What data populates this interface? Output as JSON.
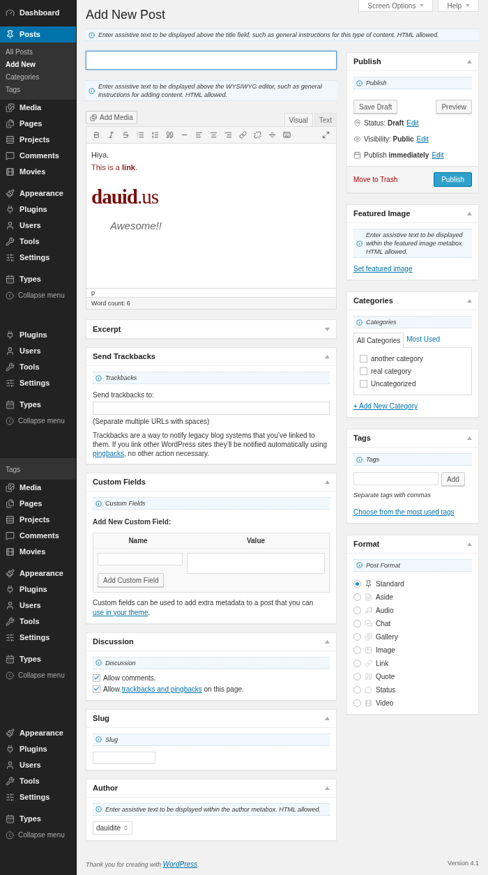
{
  "sidebar": {
    "sections": [
      {
        "groups": [
          {
            "kind": "menu",
            "items": [
              {
                "label": "Dashboard",
                "selected": false
              }
            ]
          },
          {
            "kind": "menu",
            "items": [
              {
                "label": "Posts",
                "selected": true,
                "children": [
                  {
                    "label": "All Posts",
                    "selected": false
                  },
                  {
                    "label": "Add New",
                    "selected": true
                  },
                  {
                    "label": "Categories",
                    "selected": false
                  },
                  {
                    "label": "Tags",
                    "selected": false
                  }
                ]
              },
              {
                "label": "Media",
                "selected": false
              },
              {
                "label": "Pages",
                "selected": false
              },
              {
                "label": "Projects",
                "selected": false
              },
              {
                "label": "Comments",
                "selected": false
              },
              {
                "label": "Movies",
                "selected": false
              }
            ]
          },
          {
            "kind": "menu",
            "items": [
              {
                "label": "Appearance",
                "selected": false
              },
              {
                "label": "Plugins",
                "selected": false
              },
              {
                "label": "Users",
                "selected": false
              },
              {
                "label": "Tools",
                "selected": false
              },
              {
                "label": "Settings",
                "selected": false
              }
            ]
          },
          {
            "kind": "menu",
            "items": [
              {
                "label": "Types",
                "selected": false
              }
            ]
          },
          {
            "kind": "collapse",
            "label": "Collapse menu"
          }
        ]
      },
      {
        "groups": [
          {
            "kind": "menu",
            "items": [
              {
                "label": "Plugins",
                "selected": false
              },
              {
                "label": "Users",
                "selected": false
              },
              {
                "label": "Tools",
                "selected": false
              },
              {
                "label": "Settings",
                "selected": false
              }
            ]
          },
          {
            "kind": "menu",
            "items": [
              {
                "label": "Types",
                "selected": false
              }
            ]
          },
          {
            "kind": "collapse",
            "label": "Collapse menu"
          }
        ]
      },
      {
        "groups": [
          {
            "kind": "submenu",
            "items": [
              {
                "label": "Tags",
                "selected": false
              }
            ]
          },
          {
            "kind": "menu",
            "items": [
              {
                "label": "Media",
                "selected": false
              },
              {
                "label": "Pages",
                "selected": false
              },
              {
                "label": "Projects",
                "selected": false
              },
              {
                "label": "Comments",
                "selected": false
              },
              {
                "label": "Movies",
                "selected": false
              }
            ]
          },
          {
            "kind": "menu",
            "items": [
              {
                "label": "Appearance",
                "selected": false
              },
              {
                "label": "Plugins",
                "selected": false
              },
              {
                "label": "Users",
                "selected": false
              },
              {
                "label": "Tools",
                "selected": false
              },
              {
                "label": "Settings",
                "selected": false
              }
            ]
          },
          {
            "kind": "menu",
            "items": [
              {
                "label": "Types",
                "selected": false
              }
            ]
          },
          {
            "kind": "collapse",
            "label": "Collapse menu"
          }
        ]
      },
      {
        "groups": [
          {
            "kind": "menu",
            "items": [
              {
                "label": "Appearance",
                "selected": false
              },
              {
                "label": "Plugins",
                "selected": false
              },
              {
                "label": "Users",
                "selected": false
              },
              {
                "label": "Tools",
                "selected": false
              },
              {
                "label": "Settings",
                "selected": false
              }
            ]
          },
          {
            "kind": "menu",
            "items": [
              {
                "label": "Types",
                "selected": false
              }
            ]
          },
          {
            "kind": "collapse",
            "label": "Collapse menu"
          }
        ]
      }
    ]
  },
  "header": {
    "title": "Add New Post",
    "tabs": [
      {
        "label": "Screen Options"
      },
      {
        "label": "Help"
      }
    ]
  },
  "title_hint": "Enter assistive text to be displayed above the title field, such as general instructions for this type of content. HTML allowed.",
  "editor": {
    "hint": "Enter assistive text to be displayed above the WYSIWYG editor, such as general instructions for adding content. HTML allowed.",
    "add_media": "Add Media",
    "tabs": [
      {
        "label": "Visual",
        "selected": true
      },
      {
        "label": "Text",
        "selected": false
      }
    ],
    "greeting": "Hiya.",
    "link_line": "This is a **link**.",
    "logo": "**dauid**.us",
    "quote": "Awesome!!",
    "path": "p",
    "word_count": "Word count: 6"
  },
  "main_boxes": [
    {
      "kind": "excerpt",
      "title": "Excerpt",
      "expanded": false
    },
    {
      "kind": "trackbacks",
      "title": "Send Trackbacks",
      "expanded": true,
      "hint": "Trackbacks",
      "label": "Send trackbacks to:",
      "note": "(Separate multiple URLs with spaces)",
      "text": "Trackbacks are a way to notify legacy blog systems that you’ve linked to them. If you link other WordPress sites they’ll be notified automatically using",
      "link": "pingbacks",
      "text_end": ", no other action necessary."
    },
    {
      "kind": "custom_fields",
      "title": "Custom Fields",
      "expanded": true,
      "hint": "Custom Fields",
      "heading": "Add New Custom Field:",
      "columns": [
        "Name",
        "Value"
      ],
      "button": "Add Custom Field",
      "text": "Custom fields can be used to add extra metadata to a post that you can",
      "link": "use in your theme",
      "text_end": "."
    },
    {
      "kind": "discussion",
      "title": "Discussion",
      "expanded": true,
      "hint": "Discussion",
      "options": [
        {
          "before": "Allow comments.",
          "checked": true
        },
        {
          "before": "Allow",
          "link": "trackbacks and pingbacks",
          "after": "on this page.",
          "checked": true
        }
      ]
    },
    {
      "kind": "slug",
      "title": "Slug",
      "expanded": true,
      "hint": "Slug"
    },
    {
      "kind": "author",
      "title": "Author",
      "expanded": true,
      "hint": "Enter assistive text to be displayed within the author metabox. HTML allowed.",
      "value": "dauidite"
    }
  ],
  "side_boxes": [
    {
      "kind": "publish",
      "title": "Publish",
      "expanded": true,
      "hint": "Publish",
      "save": "Save Draft",
      "preview": "Preview",
      "meta": [
        {
          "label": "Status:",
          "value": "Draft",
          "action": "Edit"
        },
        {
          "label": "Visibility:",
          "value": "Public",
          "action": "Edit"
        },
        {
          "label": "Publish",
          "value": "immediately",
          "action": "Edit"
        }
      ],
      "trash": "Move to Trash",
      "publish": "Publish"
    },
    {
      "kind": "featured",
      "title": "Featured Image",
      "expanded": true,
      "hint": "Enter assistive text to be displayed within the featured image metabox. HTML allowed.",
      "link": "Set featured image"
    },
    {
      "kind": "categories",
      "title": "Categories",
      "expanded": true,
      "hint": "Categories",
      "tabs": [
        {
          "label": "All Categories",
          "selected": true
        },
        {
          "label": "Most Used",
          "selected": false
        }
      ],
      "items": [
        {
          "label": "another category",
          "checked": false
        },
        {
          "label": "real category",
          "checked": false
        },
        {
          "label": "Uncategorized",
          "checked": false
        }
      ],
      "add": "+ Add New Category"
    },
    {
      "kind": "tags",
      "title": "Tags",
      "expanded": true,
      "hint": "Tags",
      "button": "Add",
      "note": "Separate tags with commas",
      "link": "Choose from the most used tags"
    },
    {
      "kind": "format",
      "title": "Format",
      "expanded": true,
      "hint": "Post Format",
      "options": [
        {
          "label": "Standard",
          "selected": true
        },
        {
          "label": "Aside",
          "selected": false
        },
        {
          "label": "Audio",
          "selected": false
        },
        {
          "label": "Chat",
          "selected": false
        },
        {
          "label": "Gallery",
          "selected": false
        },
        {
          "label": "Image",
          "selected": false
        },
        {
          "label": "Link",
          "selected": false
        },
        {
          "label": "Quote",
          "selected": false
        },
        {
          "label": "Status",
          "selected": false
        },
        {
          "label": "Video",
          "selected": false
        }
      ]
    }
  ],
  "footer": {
    "text": "Thank you for creating with",
    "link": "WordPress",
    "end": ".",
    "version": "Version 4.1"
  }
}
